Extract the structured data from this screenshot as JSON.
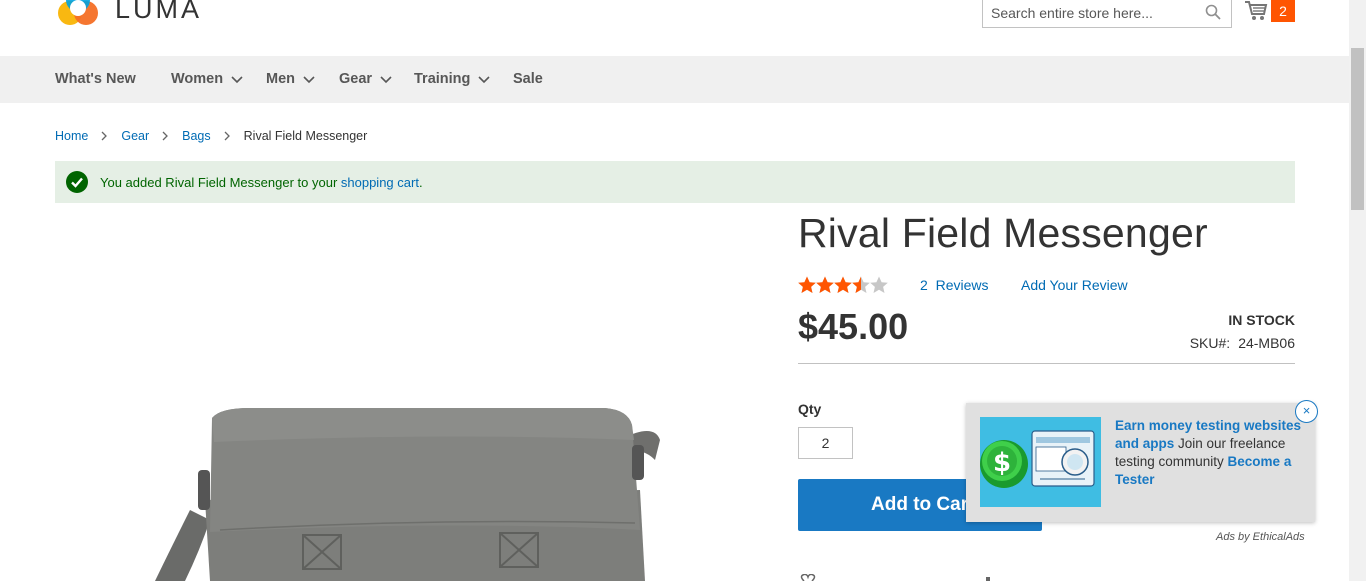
{
  "header": {
    "logo_text": "LUMA",
    "search_placeholder": "Search entire store here...",
    "cart_count": "2"
  },
  "nav": {
    "items": [
      {
        "label": "What's New"
      },
      {
        "label": "Women"
      },
      {
        "label": "Men"
      },
      {
        "label": "Gear"
      },
      {
        "label": "Training"
      },
      {
        "label": "Sale"
      }
    ]
  },
  "breadcrumb": {
    "items": [
      "Home",
      "Gear",
      "Bags"
    ],
    "current": "Rival Field Messenger"
  },
  "message": {
    "prefix": "You added Rival Field Messenger to your ",
    "link": "shopping cart",
    "suffix": "."
  },
  "product": {
    "title": "Rival Field Messenger",
    "rating_fraction": 0.7,
    "reviews_count": "2",
    "reviews_word": "Reviews",
    "add_review": "Add Your Review",
    "price": "$45.00",
    "stock": "In stock",
    "sku_label": "SKU#:",
    "sku": "24-MB06",
    "qty_label": "Qty",
    "qty_value": "2",
    "add_to_cart": "Add to Cart"
  },
  "ad": {
    "headline": "Earn money testing websites and apps",
    "body": " Join our freelance testing community ",
    "cta": "Become a Tester",
    "close": "×",
    "by": "Ads by EthicalAds"
  },
  "colors": {
    "accent": "#1979c3",
    "link": "#006bb4",
    "star": "#ff5501",
    "success_bg": "#e5efe5",
    "success_text": "#006400",
    "nav_bg": "#f0f0f0"
  }
}
